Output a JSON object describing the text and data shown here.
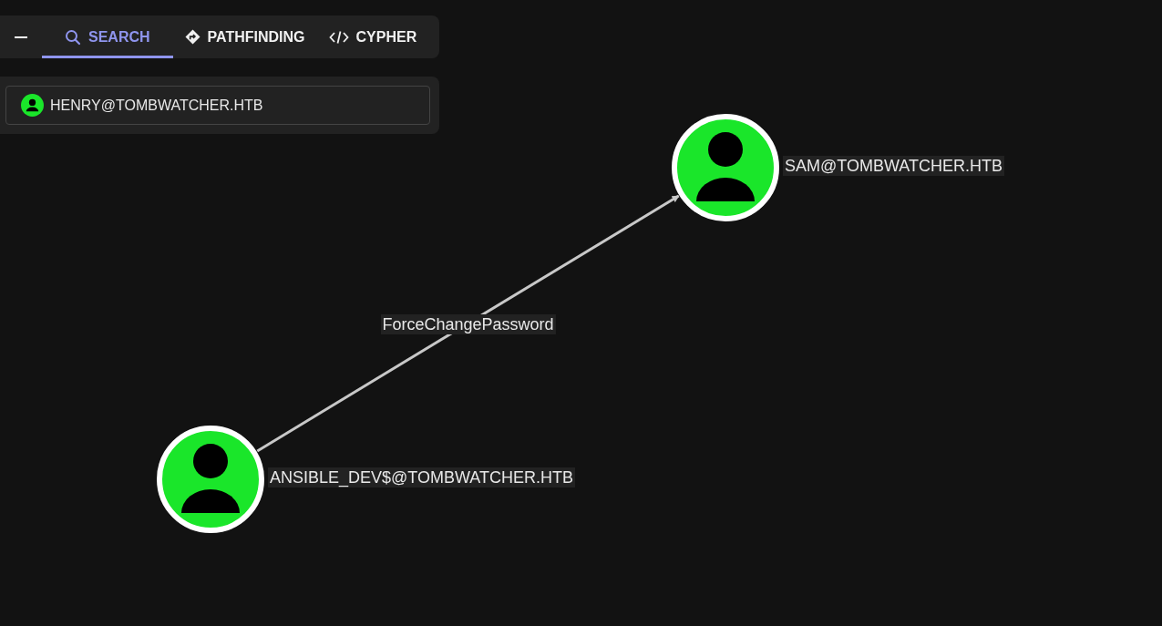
{
  "tabs": [
    {
      "label": "SEARCH",
      "kind": "search",
      "selected": true
    },
    {
      "label": "PATHFINDING",
      "kind": "pathfinding",
      "selected": false
    },
    {
      "label": "CYPHER",
      "kind": "cypher",
      "selected": false
    }
  ],
  "search": {
    "value": "HENRY@TOMBWATCHER.HTB"
  },
  "graph": {
    "nodes": [
      {
        "label": "SAM@TOMBWATCHER.HTB",
        "kind": "user"
      },
      {
        "label": "ANSIBLE_DEV$@TOMBWATCHER.HTB",
        "kind": "user"
      }
    ],
    "edges": [
      {
        "label": "ForceChangePassword"
      }
    ]
  }
}
